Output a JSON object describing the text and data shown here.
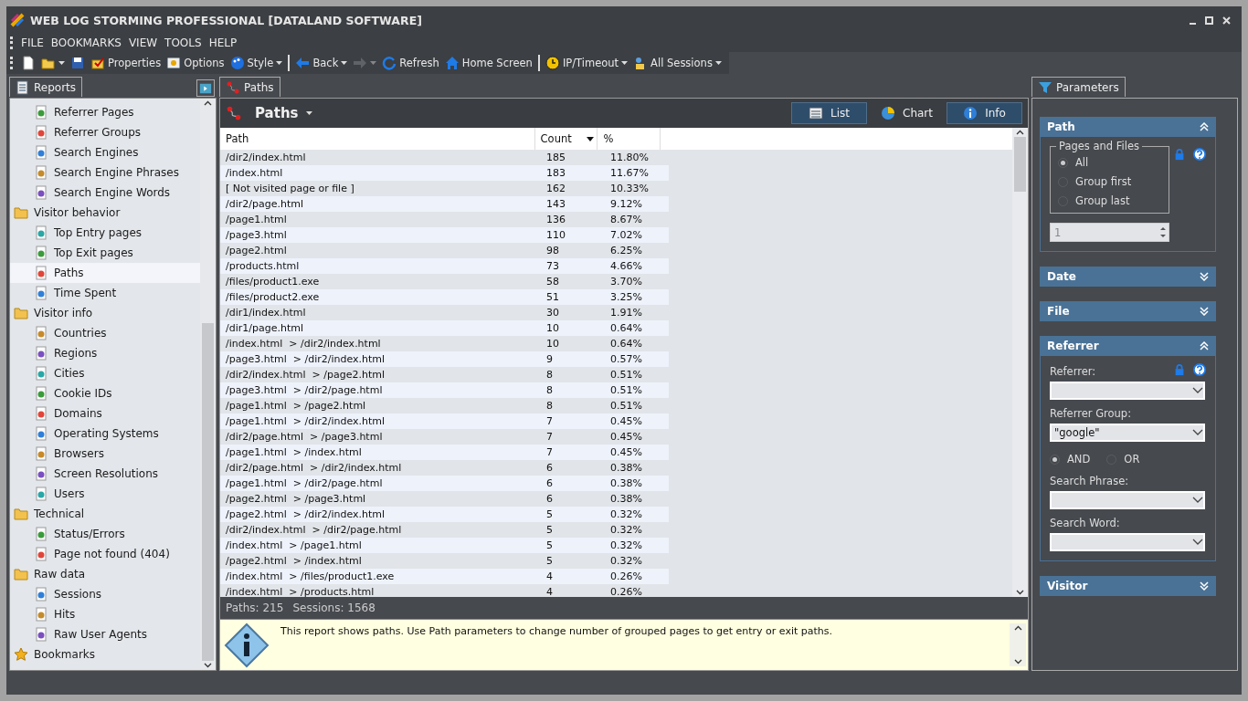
{
  "window": {
    "title": "WEB LOG STORMING PROFESSIONAL [DATALAND SOFTWARE]"
  },
  "menu": [
    "FILE",
    "BOOKMARKS",
    "VIEW",
    "TOOLS",
    "HELP"
  ],
  "toolbar": [
    {
      "kind": "icon"
    },
    {
      "kind": "icon",
      "dropdown": true
    },
    {
      "kind": "icon"
    },
    {
      "kind": "button",
      "label": "Properties"
    },
    {
      "kind": "button",
      "label": "Options"
    },
    {
      "kind": "button",
      "label": "Style",
      "dropdown": true
    },
    {
      "kind": "separator"
    },
    {
      "kind": "button",
      "label": "Back",
      "dropdown": true
    },
    {
      "kind": "icon",
      "dropdown": true,
      "disabled": true
    },
    {
      "kind": "button",
      "label": "Refresh"
    },
    {
      "kind": "button",
      "label": "Home Screen"
    },
    {
      "kind": "separator"
    },
    {
      "kind": "button",
      "label": "IP/Timeout",
      "dropdown": true
    },
    {
      "kind": "button",
      "label": "All Sessions",
      "dropdown": true
    }
  ],
  "reports_tab": {
    "label": "Reports"
  },
  "tree": [
    {
      "kind": "continued",
      "children": [
        {
          "label": "Referrer Pages",
          "selected": false
        },
        {
          "label": "Referrer Groups",
          "selected": false
        },
        {
          "label": "Search Engines",
          "selected": false
        },
        {
          "label": "Search Engine Phrases",
          "selected": false
        },
        {
          "label": "Search Engine Words",
          "selected": false
        }
      ]
    },
    {
      "kind": "folder",
      "label": "Visitor behavior",
      "children": [
        {
          "label": "Top Entry pages",
          "selected": false
        },
        {
          "label": "Top Exit pages",
          "selected": false
        },
        {
          "label": "Paths",
          "selected": true
        },
        {
          "label": "Time Spent",
          "selected": false
        }
      ]
    },
    {
      "kind": "folder",
      "label": "Visitor info",
      "children": [
        {
          "label": "Countries",
          "selected": false
        },
        {
          "label": "Regions",
          "selected": false
        },
        {
          "label": "Cities",
          "selected": false
        },
        {
          "label": "Cookie IDs",
          "selected": false
        },
        {
          "label": "Domains",
          "selected": false
        },
        {
          "label": "Operating Systems",
          "selected": false
        },
        {
          "label": "Browsers",
          "selected": false
        },
        {
          "label": "Screen Resolutions",
          "selected": false
        },
        {
          "label": "Users",
          "selected": false
        }
      ]
    },
    {
      "kind": "folder",
      "label": "Technical",
      "children": [
        {
          "label": "Status/Errors",
          "selected": false
        },
        {
          "label": "Page not found (404)",
          "selected": false
        }
      ]
    },
    {
      "kind": "folder",
      "label": "Raw data",
      "children": [
        {
          "label": "Sessions",
          "selected": false
        },
        {
          "label": "Hits",
          "selected": false
        },
        {
          "label": "Raw User Agents",
          "selected": false
        }
      ]
    },
    {
      "kind": "bookmarks",
      "label": "Bookmarks"
    }
  ],
  "report": {
    "tab": "Paths",
    "title": "Paths",
    "views": [
      {
        "label": "List",
        "on": true
      },
      {
        "label": "Chart",
        "on": false
      },
      {
        "label": "Info",
        "on": true
      }
    ],
    "columns": [
      {
        "label": "Path",
        "sorted": false
      },
      {
        "label": "Count",
        "sorted": true
      },
      {
        "label": "%",
        "sorted": false
      }
    ],
    "rows": [
      [
        "/dir2/index.html",
        "185",
        "11.80%"
      ],
      [
        "/index.html",
        "183",
        "11.67%"
      ],
      [
        "[ Not visited page or file ]",
        "162",
        "10.33%"
      ],
      [
        "/dir2/page.html",
        "143",
        "9.12%"
      ],
      [
        "/page1.html",
        "136",
        "8.67%"
      ],
      [
        "/page3.html",
        "110",
        "7.02%"
      ],
      [
        "/page2.html",
        "98",
        "6.25%"
      ],
      [
        "/products.html",
        "73",
        "4.66%"
      ],
      [
        "/files/product1.exe",
        "58",
        "3.70%"
      ],
      [
        "/files/product2.exe",
        "51",
        "3.25%"
      ],
      [
        "/dir1/index.html",
        "30",
        "1.91%"
      ],
      [
        "/dir1/page.html",
        "10",
        "0.64%"
      ],
      [
        "/index.html  > /dir2/index.html",
        "10",
        "0.64%"
      ],
      [
        "/page3.html  > /dir2/index.html",
        "9",
        "0.57%"
      ],
      [
        "/dir2/index.html  > /page2.html",
        "8",
        "0.51%"
      ],
      [
        "/page3.html  > /dir2/page.html",
        "8",
        "0.51%"
      ],
      [
        "/page1.html  > /page2.html",
        "8",
        "0.51%"
      ],
      [
        "/page1.html  > /dir2/index.html",
        "7",
        "0.45%"
      ],
      [
        "/dir2/page.html  > /page3.html",
        "7",
        "0.45%"
      ],
      [
        "/page1.html  > /index.html",
        "7",
        "0.45%"
      ],
      [
        "/dir2/page.html  > /dir2/index.html",
        "6",
        "0.38%"
      ],
      [
        "/page1.html  > /dir2/page.html",
        "6",
        "0.38%"
      ],
      [
        "/page2.html  > /page3.html",
        "6",
        "0.38%"
      ],
      [
        "/page2.html  > /dir2/index.html",
        "5",
        "0.32%"
      ],
      [
        "/dir2/index.html  > /dir2/page.html",
        "5",
        "0.32%"
      ],
      [
        "/index.html  > /page1.html",
        "5",
        "0.32%"
      ],
      [
        "/page2.html  > /index.html",
        "5",
        "0.32%"
      ],
      [
        "/index.html  > /files/product1.exe",
        "4",
        "0.26%"
      ],
      [
        "/index.html  > /products.html",
        "4",
        "0.26%"
      ]
    ],
    "summary": [
      "Paths: 215",
      "Sessions: 1568"
    ],
    "info": "This report shows paths. Use Path parameters to change number of grouped pages to get entry or exit paths."
  },
  "parameters": {
    "tab": "Parameters",
    "sections": [
      {
        "title": "Path",
        "expanded": true,
        "kind": "path",
        "group": "Pages and Files",
        "options": [
          {
            "label": "All",
            "selected": true
          },
          {
            "label": "Group first",
            "selected": false
          },
          {
            "label": "Group last",
            "selected": false
          }
        ],
        "spin": "1"
      },
      {
        "title": "Date",
        "expanded": false
      },
      {
        "title": "File",
        "expanded": false
      },
      {
        "title": "Referrer",
        "expanded": true,
        "kind": "referrer",
        "fields": [
          {
            "label": "Referrer:"
          },
          {
            "label": "Referrer Group:",
            "value": "\"google\""
          }
        ],
        "logic": [
          {
            "label": "AND",
            "selected": true
          },
          {
            "label": "OR",
            "selected": false
          }
        ],
        "fields2": [
          {
            "label": "Search Phrase:"
          },
          {
            "label": "Search Word:"
          }
        ]
      },
      {
        "title": "Visitor",
        "expanded": false
      }
    ]
  }
}
